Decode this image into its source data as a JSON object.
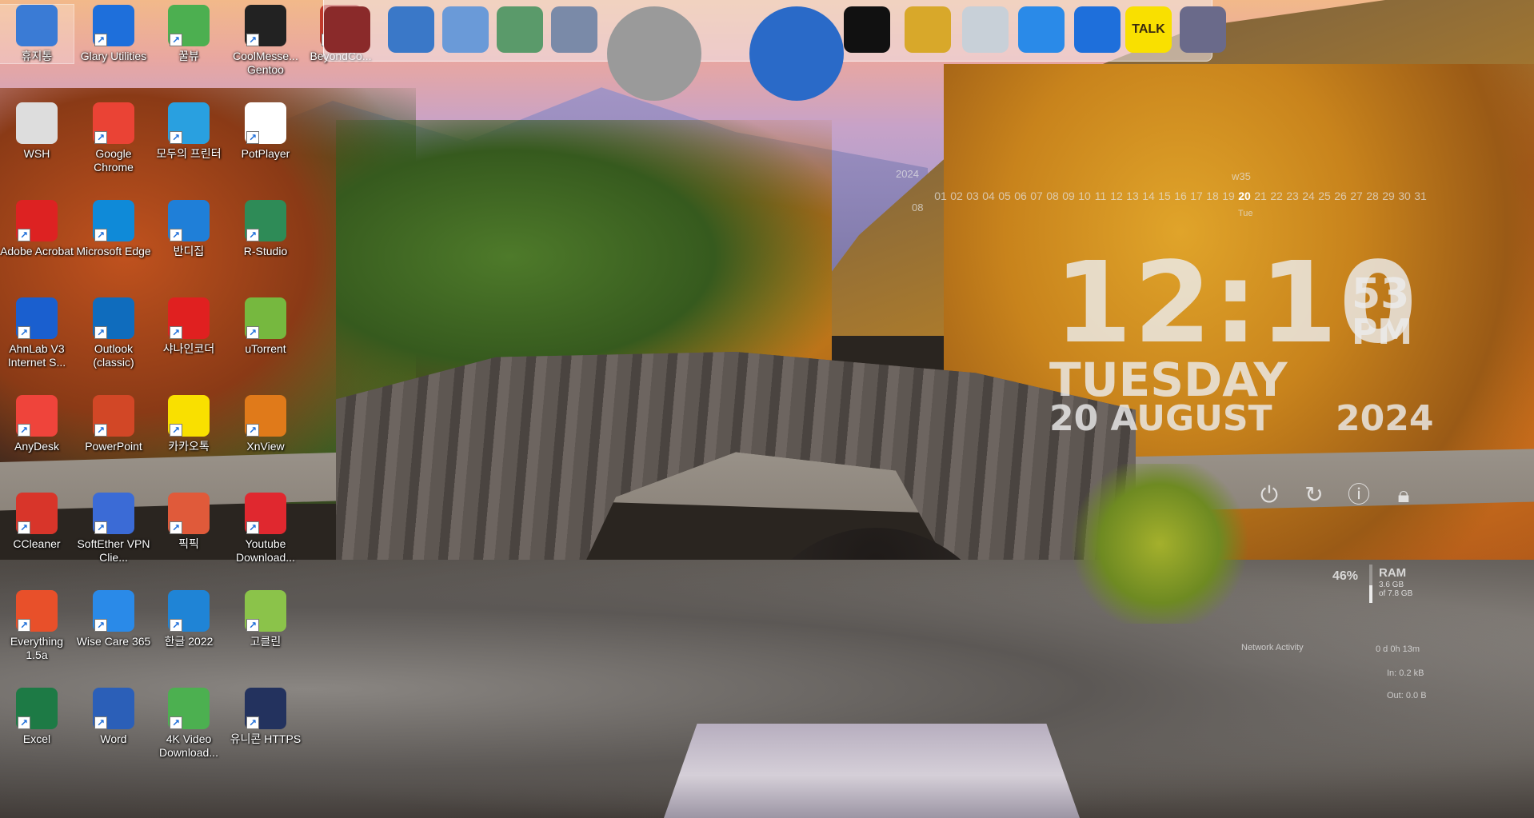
{
  "desktop": {
    "icons": [
      {
        "label": "휴지통",
        "color": "#3a7bd5"
      },
      {
        "label": "Glary Utilities",
        "color": "#1e6fdb"
      },
      {
        "label": "꿀뷰",
        "color": "#4caf50"
      },
      {
        "label": "CoolMesse... Gentoo",
        "color": "#222222"
      },
      {
        "label": "BeyondCo...",
        "color": "#c0392b"
      },
      {
        "label": "WSH",
        "color": "#dddddd"
      },
      {
        "label": "Google Chrome",
        "color": "#ea4335"
      },
      {
        "label": "모두의 프린터",
        "color": "#29a0e0"
      },
      {
        "label": "PotPlayer",
        "color": "#ffffff"
      },
      {
        "label": "Adobe Acrobat",
        "color": "#d22"
      },
      {
        "label": "Microsoft Edge",
        "color": "#0f8ad8"
      },
      {
        "label": "반디집",
        "color": "#1f7fd8"
      },
      {
        "label": "R-Studio",
        "color": "#2e8b57"
      },
      {
        "label": "AhnLab V3 Internet S...",
        "color": "#1a5fcf"
      },
      {
        "label": "Outlook (classic)",
        "color": "#0f6cbd"
      },
      {
        "label": "샤나인코더",
        "color": "#e02020"
      },
      {
        "label": "uTorrent",
        "color": "#76b83f"
      },
      {
        "label": "AnyDesk",
        "color": "#ef443b"
      },
      {
        "label": "PowerPoint",
        "color": "#d24726"
      },
      {
        "label": "카카오톡",
        "color": "#f9e000"
      },
      {
        "label": "XnView",
        "color": "#e07a1a"
      },
      {
        "label": "CCleaner",
        "color": "#d8352a"
      },
      {
        "label": "SoftEther VPN Clie...",
        "color": "#3b6bd6"
      },
      {
        "label": "픽픽",
        "color": "#e05a3a"
      },
      {
        "label": "Youtube Download...",
        "color": "#e0282f"
      },
      {
        "label": "Everything 1.5a",
        "color": "#e8502a"
      },
      {
        "label": "Wise Care 365",
        "color": "#2a8ae8"
      },
      {
        "label": "한글 2022",
        "color": "#1f84d6"
      },
      {
        "label": "고클린",
        "color": "#8bc34a"
      },
      {
        "label": "Excel",
        "color": "#1d7a45"
      },
      {
        "label": "Word",
        "color": "#2b5fb8"
      },
      {
        "label": "4K Video Download...",
        "color": "#4cb050"
      },
      {
        "label": "유니콘 HTTPS",
        "color": "#23325e"
      }
    ]
  },
  "dock": {
    "items": [
      {
        "name": "disk-utility",
        "color": "#8a2a2a",
        "text": ""
      },
      {
        "name": "network",
        "color": "#3a78c8",
        "text": ""
      },
      {
        "name": "folder-1",
        "color": "#6a9ad8",
        "text": ""
      },
      {
        "name": "folder-2",
        "color": "#5a9a6a",
        "text": ""
      },
      {
        "name": "folder-3",
        "color": "#7a8aa8",
        "text": ""
      },
      {
        "name": "tools",
        "color": "#9a9a9a",
        "text": ""
      },
      {
        "name": "globe",
        "color": "#2a6ac8",
        "text": ""
      },
      {
        "name": "tshirt",
        "color": "#111111",
        "text": ""
      },
      {
        "name": "hammer",
        "color": "#d8a82a",
        "text": ""
      },
      {
        "name": "recycle",
        "color": "#c8d0d8",
        "text": ""
      },
      {
        "name": "wise-care",
        "color": "#2a8ae8",
        "text": ""
      },
      {
        "name": "glary",
        "color": "#1e6fdb",
        "text": ""
      },
      {
        "name": "kakaotalk",
        "color": "#f9e000",
        "text": "TALK"
      },
      {
        "name": "r-studio",
        "color": "#6a6a8a",
        "text": ""
      }
    ]
  },
  "calendar": {
    "year": "2024",
    "month": "08",
    "week": "w35",
    "today_label": "Tue",
    "days": [
      "01",
      "02",
      "03",
      "04",
      "05",
      "06",
      "07",
      "08",
      "09",
      "10",
      "11",
      "12",
      "13",
      "14",
      "15",
      "16",
      "17",
      "18",
      "19",
      "20",
      "21",
      "22",
      "23",
      "24",
      "25",
      "26",
      "27",
      "28",
      "29",
      "30",
      "31"
    ],
    "today_index": 19
  },
  "clock": {
    "time": "12:10",
    "seconds": "53",
    "ampm": "PM",
    "weekday": "TUESDAY",
    "date": "20 AUGUST",
    "year": "2024"
  },
  "system": {
    "ram_percent": "46%",
    "ram_fraction": 0.46,
    "ram_label": "RAM",
    "ram_used": "3.6 GB",
    "ram_total": "of 7.8 GB",
    "network_title": "Network Activity",
    "uptime": "0 d 0h 13m",
    "net_in": "In: 0.2 kB",
    "net_out": "Out: 0.0 B"
  }
}
